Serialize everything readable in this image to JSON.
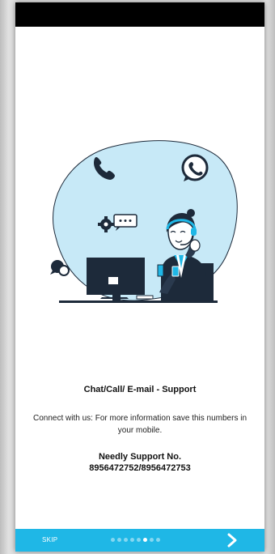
{
  "onboarding": {
    "title": "Chat/Call/ E-mail - Support",
    "description": "Connect with us: For more information save this numbers in your mobile.",
    "support_label": "Needly Support No.",
    "support_number": "8956472752/8956472753"
  },
  "footer": {
    "skip_label": "SKIP",
    "total_pages": 8,
    "active_page": 6,
    "next_icon": "chevron-right-icon"
  },
  "colors": {
    "accent": "#1fb7e6",
    "blob": "#c7e9f7",
    "dark": "#1d2a3a",
    "status_bar": "#000000"
  },
  "icons": [
    "phone-icon",
    "whatsapp-icon",
    "chat-settings-icon",
    "chat-bubbles-icon",
    "support-agent-illustration"
  ]
}
